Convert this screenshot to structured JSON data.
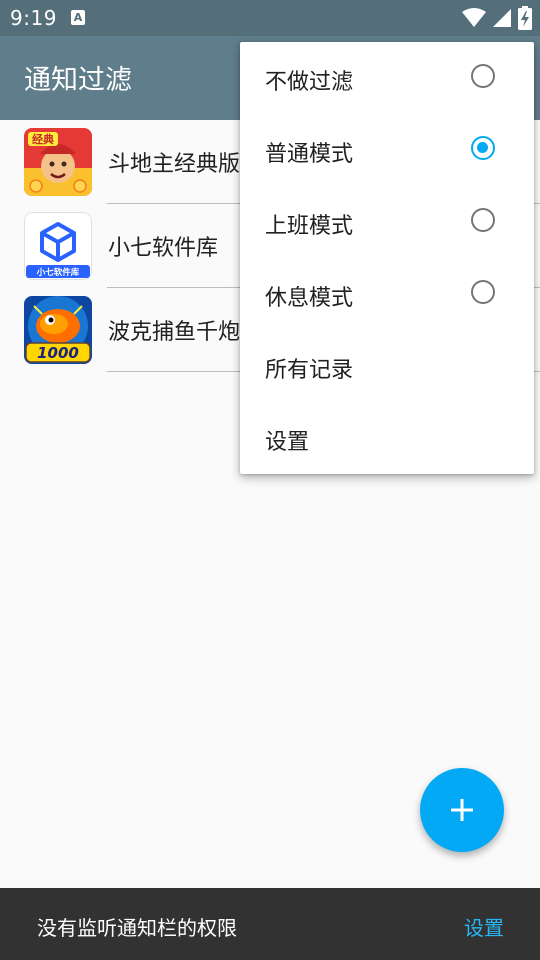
{
  "status_bar": {
    "time": "9:19",
    "notification_icon_letter": "A",
    "icons": [
      "wifi-icon",
      "cell-signal-icon",
      "battery-charging-icon"
    ]
  },
  "app_bar": {
    "title": "通知过滤"
  },
  "app_list": [
    {
      "label": "斗地主经典版",
      "icon": "doudizhu-app-icon"
    },
    {
      "label": "小七软件库",
      "icon": "xiaoqi-app-icon",
      "icon_caption": "小七软件库"
    },
    {
      "label": "波克捕鱼千炮",
      "icon": "bokebuyu-app-icon",
      "icon_caption": "1000"
    }
  ],
  "menu": {
    "items": [
      {
        "label": "不做过滤",
        "type": "radio",
        "checked": false
      },
      {
        "label": "普通模式",
        "type": "radio",
        "checked": true
      },
      {
        "label": "上班模式",
        "type": "radio",
        "checked": false
      },
      {
        "label": "休息模式",
        "type": "radio",
        "checked": false
      },
      {
        "label": "所有记录",
        "type": "action"
      },
      {
        "label": "设置",
        "type": "action"
      }
    ]
  },
  "fab": {
    "icon": "plus-icon"
  },
  "snackbar": {
    "message": "没有监听通知栏的权限",
    "action": "设置"
  },
  "colors": {
    "status_bar": "#546e7a",
    "app_bar": "#607d8b",
    "accent": "#03a9f4",
    "snackbar_bg": "#323232",
    "snackbar_action": "#29b6f6"
  }
}
